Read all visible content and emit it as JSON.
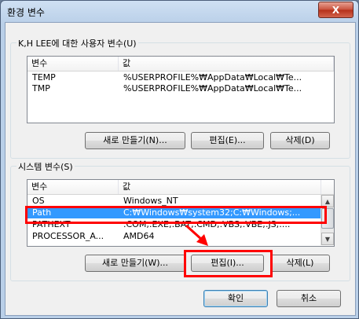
{
  "window": {
    "title": "환경 변수",
    "close_label": "X"
  },
  "user_vars": {
    "group_label": "K,H LEE에 대한 사용자 변수(U)",
    "columns": [
      "변수",
      "값"
    ],
    "rows": [
      {
        "name": "TEMP",
        "value": "%USERPROFILE%₩AppData₩Local₩Te..."
      },
      {
        "name": "TMP",
        "value": "%USERPROFILE%₩AppData₩Local₩Te..."
      }
    ],
    "new_label": "새로 만들기(N)...",
    "edit_label": "편집(E)...",
    "delete_label": "삭제(D)"
  },
  "system_vars": {
    "group_label": "시스템 변수(S)",
    "columns": [
      "변수",
      "값"
    ],
    "rows": [
      {
        "name": "OS",
        "value": "Windows_NT",
        "selected": false
      },
      {
        "name": "Path",
        "value": "C:₩Windows₩system32;C:₩Windows;...",
        "selected": true
      },
      {
        "name": "PATHEXT",
        "value": ".COM;.EXE;.BAT;.CMD;.VBS;.VBE;.JS;....",
        "selected": false
      },
      {
        "name": "PROCESSOR_A...",
        "value": "AMD64",
        "selected": false
      }
    ],
    "new_label": "새로 만들기(W)...",
    "edit_label": "편집(I)...",
    "delete_label": "삭제(L)"
  },
  "footer": {
    "ok_label": "확인",
    "cancel_label": "취소"
  },
  "colors": {
    "highlight": "#3399ff",
    "annotation": "#ff0000"
  }
}
